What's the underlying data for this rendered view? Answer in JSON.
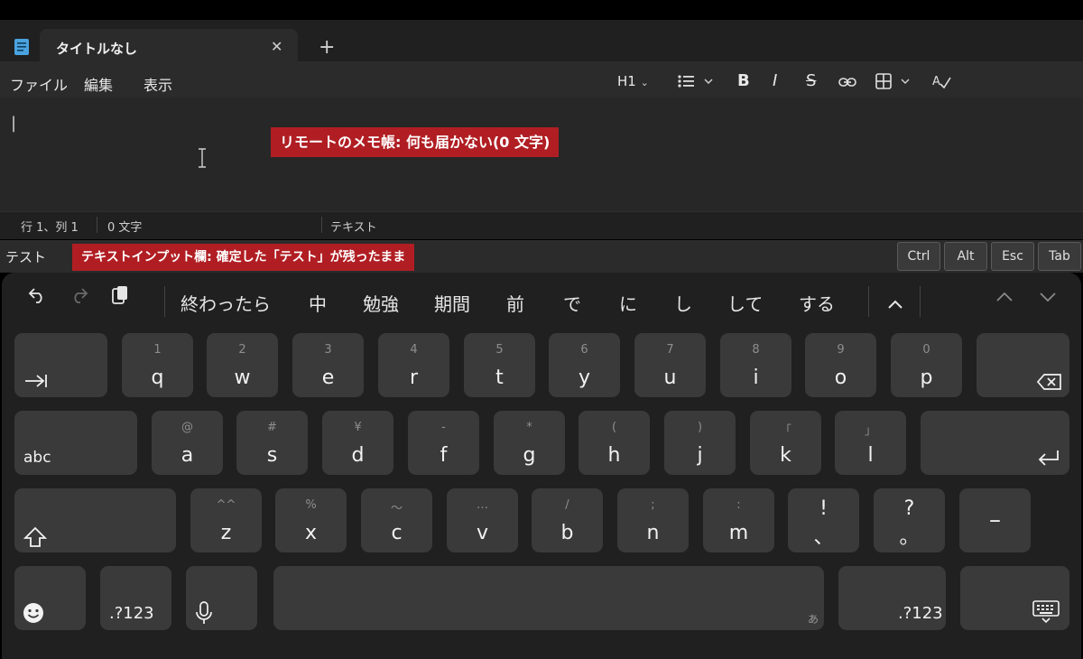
{
  "window": {
    "tab_title": "タイトルなし",
    "close_glyph": "✕",
    "new_tab_glyph": "+"
  },
  "menu": {
    "file": "ファイル",
    "edit": "編集",
    "view": "表示"
  },
  "format_toolbar": {
    "heading": "H1",
    "bold": "B",
    "italic": "I",
    "strike": "S"
  },
  "editor": {
    "cursor": "|",
    "annotation": "リモートのメモ帳: 何も届かない(0 文字)"
  },
  "status": {
    "position": "行 1、列 1",
    "chars": "0 文字",
    "mode": "テキスト"
  },
  "input_bar": {
    "text": "テスト",
    "annotation": "テキストインプット欄: 確定した「テスト」が残ったまま",
    "keys": [
      "Ctrl",
      "Alt",
      "Esc",
      "Tab"
    ]
  },
  "candidates": [
    "終わったら",
    "中",
    "勉強",
    "期間",
    "前",
    "で",
    "に",
    "し",
    "して",
    "する"
  ],
  "keyboard": {
    "row1": [
      {
        "k": "q",
        "s": "1"
      },
      {
        "k": "w",
        "s": "2"
      },
      {
        "k": "e",
        "s": "3"
      },
      {
        "k": "r",
        "s": "4"
      },
      {
        "k": "t",
        "s": "5"
      },
      {
        "k": "y",
        "s": "6"
      },
      {
        "k": "u",
        "s": "7"
      },
      {
        "k": "i",
        "s": "8"
      },
      {
        "k": "o",
        "s": "9"
      },
      {
        "k": "p",
        "s": "0"
      }
    ],
    "row2": [
      {
        "k": "a",
        "s": "@"
      },
      {
        "k": "s",
        "s": "#"
      },
      {
        "k": "d",
        "s": "¥"
      },
      {
        "k": "f",
        "s": "-"
      },
      {
        "k": "g",
        "s": "*"
      },
      {
        "k": "h",
        "s": "("
      },
      {
        "k": "j",
        "s": ")"
      },
      {
        "k": "k",
        "s": "「"
      },
      {
        "k": "l",
        "s": "」"
      }
    ],
    "row3": [
      {
        "k": "z",
        "s": "^^"
      },
      {
        "k": "x",
        "s": "%"
      },
      {
        "k": "c",
        "s": "〜"
      },
      {
        "k": "v",
        "s": "…"
      },
      {
        "k": "b",
        "s": "/"
      },
      {
        "k": "n",
        "s": ";"
      },
      {
        "k": "m",
        "s": ":"
      },
      {
        "k": "!",
        "s": "、"
      },
      {
        "k": "?",
        "s": "。"
      }
    ],
    "abc_label": "abc",
    "num_label": ".?123",
    "num_label_right": ".?123",
    "dash_label": "–",
    "space_hint": "あ"
  }
}
